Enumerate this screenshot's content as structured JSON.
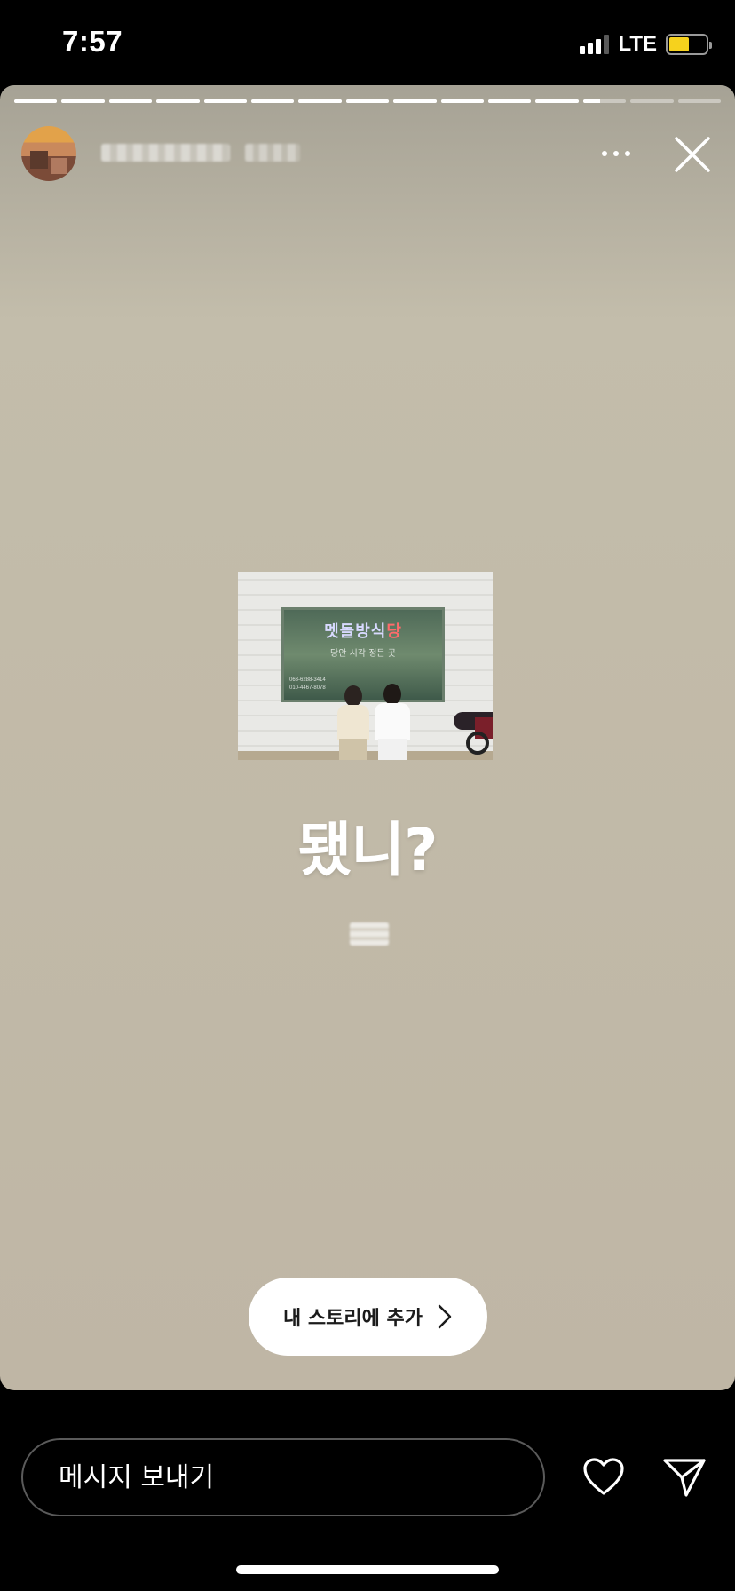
{
  "status_bar": {
    "time": "7:57",
    "network": "LTE",
    "signal_bars_filled": 3,
    "battery_level": 0.55,
    "battery_color": "#f6d21d"
  },
  "story": {
    "segments_total": 15,
    "segments_completed": 12,
    "current_segment_progress": 0.4,
    "username": "",
    "posted_time": "",
    "photo": {
      "sign_text_blue": "멧돌방식",
      "sign_text_red": "당",
      "sign_subtext": "당안 시각 정든 곳",
      "phone_lines": [
        "063-6288-3414",
        "010-4467-8078"
      ]
    },
    "text": "됐니?",
    "add_to_story_label": "내 스토리에 추가"
  },
  "bottom_bar": {
    "message_placeholder": "메시지 보내기"
  },
  "icons": {
    "more": "more-icon",
    "close": "close-icon",
    "heart": "heart-icon",
    "send": "send-icon",
    "chevron": "chevron-right-icon"
  }
}
